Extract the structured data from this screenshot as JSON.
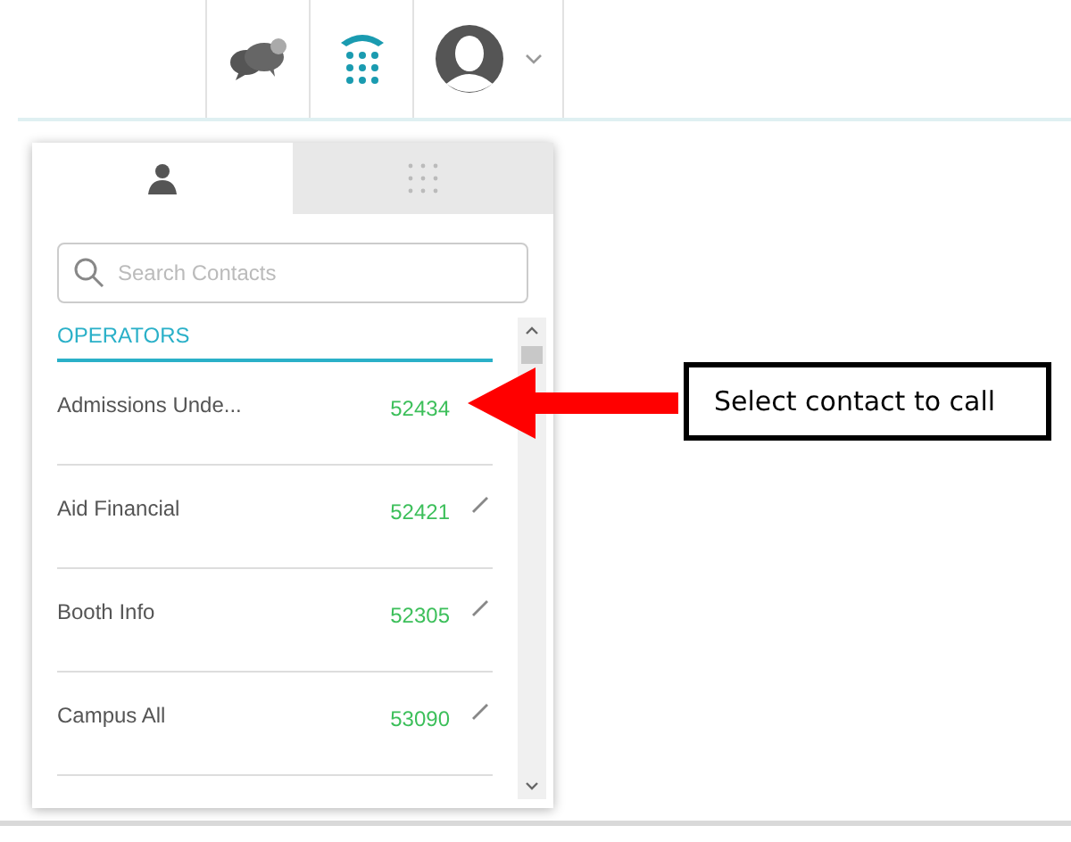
{
  "search": {
    "placeholder": "Search Contacts"
  },
  "tabs": [
    {
      "kind": "contacts",
      "selected": true
    },
    {
      "kind": "keypad",
      "selected": false
    }
  ],
  "section": "OPERATORS",
  "contacts": [
    {
      "name": "Admissions Unde...",
      "number": "52434",
      "editable": false
    },
    {
      "name": "Aid Financial",
      "number": "52421",
      "editable": true
    },
    {
      "name": "Booth Info",
      "number": "52305",
      "editable": true
    },
    {
      "name": "Campus All",
      "number": "53090",
      "editable": true
    }
  ],
  "callout": "Select contact to call"
}
